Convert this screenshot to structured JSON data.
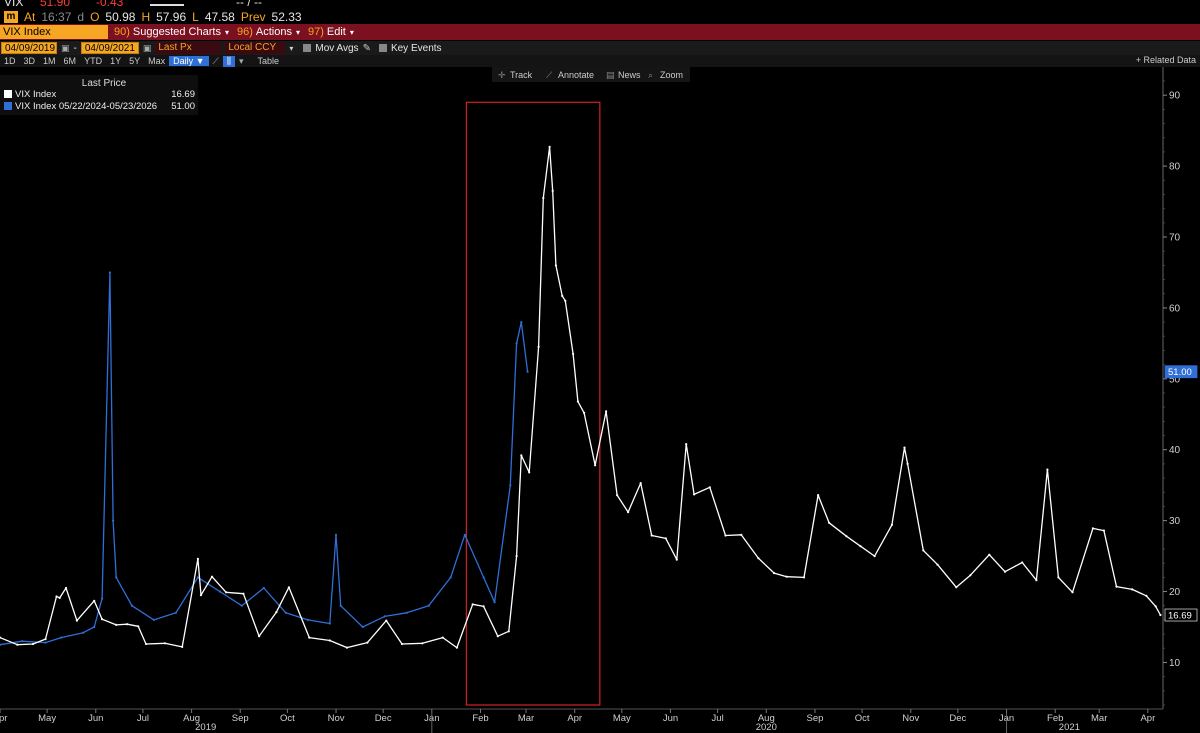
{
  "header": {
    "ticker": "VIX",
    "last": "51.90",
    "change": "-0.43",
    "at_label": "At",
    "time": "16:37",
    "time_suffix": "d",
    "open_label": "O",
    "open": "50.98",
    "high_label": "H",
    "high": "57.96",
    "low_label": "L",
    "low": "47.58",
    "prev_label": "Prev",
    "prev": "52.33",
    "dash_text": "-- / --"
  },
  "menu": {
    "security": "VIX Index",
    "items": [
      {
        "num": "90)",
        "label": "Suggested Charts"
      },
      {
        "num": "96)",
        "label": "Actions"
      },
      {
        "num": "97)",
        "label": "Edit"
      }
    ]
  },
  "controls": {
    "start_date": "04/09/2019",
    "end_date": "04/09/2021",
    "field": "Last Px",
    "currency": "Local CCY",
    "mov_avgs": "Mov Avgs",
    "key_events": "Key Events"
  },
  "toolbar": {
    "periods": [
      "1D",
      "3D",
      "1M",
      "6M",
      "YTD",
      "1Y",
      "5Y",
      "Max"
    ],
    "frequency": "Daily",
    "table": "Table",
    "related": "+ Related Data",
    "tools": [
      "Track",
      "Annotate",
      "News",
      "Zoom"
    ]
  },
  "legend": {
    "header": "Last Price",
    "items": [
      {
        "label": "VIX Index",
        "value": "16.69",
        "color": "#ffffff"
      },
      {
        "label": "VIX Index 05/22/2024-05/23/2026",
        "value": "51.00",
        "color": "#2f6fd6"
      }
    ]
  },
  "colors": {
    "background": "#000000",
    "series_primary": "#ffffff",
    "series_overlay": "#2f6fd6",
    "highlight_box": "#d42020",
    "axis_text": "#cfcfcf",
    "menu_bar": "#7a1020",
    "accent": "#f5a623"
  },
  "chart_data": {
    "type": "line",
    "ylim": [
      4,
      92
    ],
    "y_ticks": [
      10,
      20,
      30,
      40,
      50,
      60,
      70,
      80,
      90
    ],
    "x_range": [
      "2019-04-01",
      "2021-04-10"
    ],
    "x_ticks": [
      {
        "date": "2019-04-01",
        "label": "Apr"
      },
      {
        "date": "2019-05-01",
        "label": "May"
      },
      {
        "date": "2019-06-01",
        "label": "Jun"
      },
      {
        "date": "2019-07-01",
        "label": "Jul"
      },
      {
        "date": "2019-08-01",
        "label": "Aug"
      },
      {
        "date": "2019-09-01",
        "label": "Sep"
      },
      {
        "date": "2019-10-01",
        "label": "Oct"
      },
      {
        "date": "2019-11-01",
        "label": "Nov"
      },
      {
        "date": "2019-12-01",
        "label": "Dec"
      },
      {
        "date": "2020-01-01",
        "label": "Jan"
      },
      {
        "date": "2020-02-01",
        "label": "Feb"
      },
      {
        "date": "2020-03-01",
        "label": "Mar"
      },
      {
        "date": "2020-04-01",
        "label": "Apr"
      },
      {
        "date": "2020-05-01",
        "label": "May"
      },
      {
        "date": "2020-06-01",
        "label": "Jun"
      },
      {
        "date": "2020-07-01",
        "label": "Jul"
      },
      {
        "date": "2020-08-01",
        "label": "Aug"
      },
      {
        "date": "2020-09-01",
        "label": "Sep"
      },
      {
        "date": "2020-10-01",
        "label": "Oct"
      },
      {
        "date": "2020-11-01",
        "label": "Nov"
      },
      {
        "date": "2020-12-01",
        "label": "Dec"
      },
      {
        "date": "2021-01-01",
        "label": "Jan"
      },
      {
        "date": "2021-02-01",
        "label": "Feb"
      },
      {
        "date": "2021-03-01",
        "label": "Mar"
      },
      {
        "date": "2021-04-01",
        "label": "Apr"
      }
    ],
    "year_labels": [
      {
        "date": "2019-08-10",
        "label": "2019"
      },
      {
        "date": "2020-08-01",
        "label": "2020"
      },
      {
        "date": "2021-02-10",
        "label": "2021"
      }
    ],
    "year_dividers": [
      "2020-01-01",
      "2021-01-01"
    ],
    "highlight_range": {
      "x": [
        "2020-01-23",
        "2020-04-17"
      ],
      "y": [
        4,
        89
      ]
    },
    "last_value_labels": [
      {
        "series": 1,
        "value": 51.0
      },
      {
        "series": 0,
        "value": 16.69
      }
    ],
    "series": [
      {
        "name": "VIX Index",
        "color": "#ffffff",
        "points": [
          [
            "2019-04-01",
            13.5
          ],
          [
            "2019-04-12",
            12.5
          ],
          [
            "2019-04-22",
            12.6
          ],
          [
            "2019-04-30",
            13.3
          ],
          [
            "2019-05-07",
            19.3
          ],
          [
            "2019-05-09",
            19.1
          ],
          [
            "2019-05-13",
            20.5
          ],
          [
            "2019-05-20",
            15.9
          ],
          [
            "2019-05-31",
            18.7
          ],
          [
            "2019-06-05",
            16.1
          ],
          [
            "2019-06-14",
            15.3
          ],
          [
            "2019-06-21",
            15.4
          ],
          [
            "2019-06-28",
            15.1
          ],
          [
            "2019-07-03",
            12.6
          ],
          [
            "2019-07-15",
            12.7
          ],
          [
            "2019-07-26",
            12.2
          ],
          [
            "2019-08-05",
            24.6
          ],
          [
            "2019-08-07",
            19.5
          ],
          [
            "2019-08-14",
            22.1
          ],
          [
            "2019-08-23",
            19.9
          ],
          [
            "2019-09-03",
            19.7
          ],
          [
            "2019-09-13",
            13.7
          ],
          [
            "2019-09-24",
            17.1
          ],
          [
            "2019-10-02",
            20.6
          ],
          [
            "2019-10-15",
            13.5
          ],
          [
            "2019-10-28",
            13.1
          ],
          [
            "2019-11-08",
            12.1
          ],
          [
            "2019-11-21",
            12.8
          ],
          [
            "2019-12-03",
            15.9
          ],
          [
            "2019-12-13",
            12.6
          ],
          [
            "2019-12-26",
            12.7
          ],
          [
            "2020-01-08",
            13.5
          ],
          [
            "2020-01-17",
            12.1
          ],
          [
            "2020-01-27",
            18.2
          ],
          [
            "2020-02-03",
            17.9
          ],
          [
            "2020-02-12",
            13.7
          ],
          [
            "2020-02-19",
            14.4
          ],
          [
            "2020-02-24",
            25.0
          ],
          [
            "2020-02-27",
            39.2
          ],
          [
            "2020-03-03",
            36.8
          ],
          [
            "2020-03-09",
            54.5
          ],
          [
            "2020-03-12",
            75.5
          ],
          [
            "2020-03-16",
            82.7
          ],
          [
            "2020-03-18",
            76.5
          ],
          [
            "2020-03-20",
            66.0
          ],
          [
            "2020-03-24",
            61.7
          ],
          [
            "2020-03-26",
            61.0
          ],
          [
            "2020-03-31",
            53.5
          ],
          [
            "2020-04-03",
            46.8
          ],
          [
            "2020-04-07",
            45.2
          ],
          [
            "2020-04-14",
            37.8
          ],
          [
            "2020-04-21",
            45.4
          ],
          [
            "2020-04-28",
            33.6
          ],
          [
            "2020-05-05",
            31.2
          ],
          [
            "2020-05-13",
            35.3
          ],
          [
            "2020-05-20",
            27.9
          ],
          [
            "2020-05-29",
            27.5
          ],
          [
            "2020-06-05",
            24.5
          ],
          [
            "2020-06-11",
            40.8
          ],
          [
            "2020-06-16",
            33.7
          ],
          [
            "2020-06-26",
            34.7
          ],
          [
            "2020-07-06",
            27.9
          ],
          [
            "2020-07-16",
            28.0
          ],
          [
            "2020-07-27",
            24.7
          ],
          [
            "2020-08-06",
            22.6
          ],
          [
            "2020-08-14",
            22.1
          ],
          [
            "2020-08-25",
            22.0
          ],
          [
            "2020-09-03",
            33.6
          ],
          [
            "2020-09-10",
            29.7
          ],
          [
            "2020-09-21",
            27.8
          ],
          [
            "2020-09-30",
            26.4
          ],
          [
            "2020-10-09",
            25.0
          ],
          [
            "2020-10-20",
            29.4
          ],
          [
            "2020-10-28",
            40.3
          ],
          [
            "2020-10-30",
            38.0
          ],
          [
            "2020-11-09",
            25.8
          ],
          [
            "2020-11-18",
            23.8
          ],
          [
            "2020-11-30",
            20.6
          ],
          [
            "2020-12-09",
            22.3
          ],
          [
            "2020-12-21",
            25.2
          ],
          [
            "2020-12-31",
            22.8
          ],
          [
            "2021-01-11",
            24.1
          ],
          [
            "2021-01-20",
            21.6
          ],
          [
            "2021-01-27",
            37.2
          ],
          [
            "2021-02-03",
            22.0
          ],
          [
            "2021-02-12",
            19.9
          ],
          [
            "2021-02-25",
            28.9
          ],
          [
            "2021-03-04",
            28.6
          ],
          [
            "2021-03-12",
            20.7
          ],
          [
            "2021-03-22",
            20.3
          ],
          [
            "2021-03-31",
            19.4
          ],
          [
            "2021-04-06",
            17.9
          ],
          [
            "2021-04-09",
            16.69
          ]
        ]
      },
      {
        "name": "VIX Index 05/22/2024-05/23/2026",
        "color": "#2f6fd6",
        "points": [
          [
            "2019-04-01",
            12.5
          ],
          [
            "2019-04-15",
            13.0
          ],
          [
            "2019-04-30",
            12.8
          ],
          [
            "2019-05-10",
            13.5
          ],
          [
            "2019-05-24",
            14.2
          ],
          [
            "2019-05-31",
            15.0
          ],
          [
            "2019-06-05",
            19.0
          ],
          [
            "2019-06-10",
            65.0
          ],
          [
            "2019-06-12",
            30.0
          ],
          [
            "2019-06-14",
            22.0
          ],
          [
            "2019-06-24",
            18.0
          ],
          [
            "2019-07-08",
            16.0
          ],
          [
            "2019-07-22",
            17.0
          ],
          [
            "2019-08-05",
            22.0
          ],
          [
            "2019-08-19",
            20.0
          ],
          [
            "2019-09-02",
            18.0
          ],
          [
            "2019-09-16",
            20.5
          ],
          [
            "2019-09-30",
            17.0
          ],
          [
            "2019-10-14",
            16.0
          ],
          [
            "2019-10-28",
            15.5
          ],
          [
            "2019-11-01",
            28.0
          ],
          [
            "2019-11-04",
            18.0
          ],
          [
            "2019-11-18",
            15.0
          ],
          [
            "2019-12-02",
            16.5
          ],
          [
            "2019-12-16",
            17.0
          ],
          [
            "2019-12-30",
            18.0
          ],
          [
            "2020-01-13",
            22.0
          ],
          [
            "2020-01-22",
            28.0
          ],
          [
            "2020-02-03",
            22.0
          ],
          [
            "2020-02-10",
            18.5
          ],
          [
            "2020-02-20",
            35.0
          ],
          [
            "2020-02-24",
            55.0
          ],
          [
            "2020-02-27",
            58.0
          ],
          [
            "2020-03-02",
            51.0
          ]
        ]
      }
    ]
  }
}
